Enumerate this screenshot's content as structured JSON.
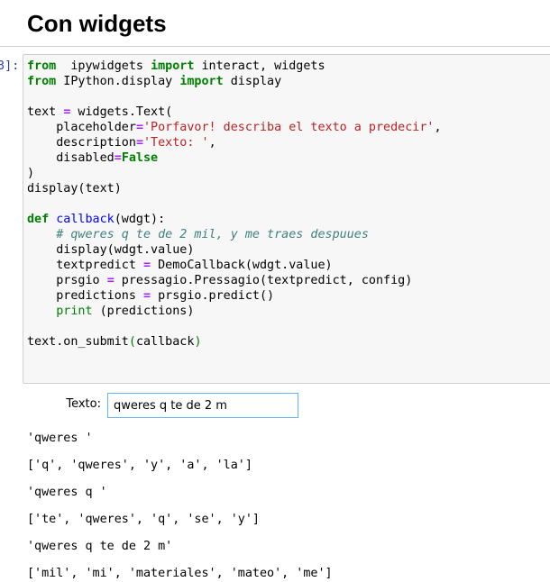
{
  "heading": "Con widgets",
  "cell_prompt": "3]:",
  "code_lines": [
    [
      [
        "kw",
        "from"
      ],
      [
        "",
        "  ipywidgets "
      ],
      [
        "kw",
        "import"
      ],
      [
        "",
        " interact, widgets"
      ]
    ],
    [
      [
        "kw",
        "from"
      ],
      [
        "",
        " IPython.display "
      ],
      [
        "kw",
        "import"
      ],
      [
        "",
        " display"
      ]
    ],
    [],
    [
      [
        "",
        "text "
      ],
      [
        "op",
        "="
      ],
      [
        "",
        " widgets.Text("
      ]
    ],
    [
      [
        "",
        "    placeholder"
      ],
      [
        "op",
        "="
      ],
      [
        "st",
        "'Porfavor! describa el texto a predecir'"
      ],
      [
        "",
        ","
      ]
    ],
    [
      [
        "",
        "    description"
      ],
      [
        "op",
        "="
      ],
      [
        "st",
        "'Texto: '"
      ],
      [
        "",
        ","
      ]
    ],
    [
      [
        "",
        "    disabled"
      ],
      [
        "op",
        "="
      ],
      [
        "kw",
        "False"
      ]
    ],
    [
      [
        "",
        ")"
      ]
    ],
    [
      [
        "",
        "display(text)"
      ]
    ],
    [],
    [
      [
        "kw",
        "def"
      ],
      [
        "",
        " "
      ],
      [
        "fn",
        "callback"
      ],
      [
        "",
        "(wdgt):"
      ]
    ],
    [
      [
        "cm",
        "    # qweres q te de 2 mil, y me traes despuues"
      ]
    ],
    [
      [
        "",
        "    display(wdgt.value)"
      ]
    ],
    [
      [
        "",
        "    textpredict "
      ],
      [
        "op",
        "="
      ],
      [
        "",
        " DemoCallback(wdgt.value)"
      ]
    ],
    [
      [
        "",
        "    prsgio "
      ],
      [
        "op",
        "="
      ],
      [
        "",
        " pressagio.Pressagio(textpredict, config)"
      ]
    ],
    [
      [
        "",
        "    predictions "
      ],
      [
        "op",
        "="
      ],
      [
        "",
        " prsgio.predict()"
      ]
    ],
    [
      [
        "pr",
        "    print"
      ],
      [
        "",
        " (predictions)"
      ]
    ],
    [],
    [
      [
        "",
        "text.on_submit"
      ],
      [
        "pr",
        "("
      ],
      [
        "",
        "callback"
      ],
      [
        "pr",
        ")"
      ]
    ]
  ],
  "widget": {
    "label": "Texto:",
    "value": "qweres q te de 2 m",
    "placeholder": "Porfavor! describa el texto a predecir"
  },
  "outputs": [
    "'qweres '",
    "['q', 'qweres', 'y', 'a', 'la']",
    "'qweres q '",
    "['te', 'qweres', 'q', 'se', 'y']",
    "'qweres q te de 2 m'",
    "['mil', 'mi', 'materiales', 'mateo', 'me']"
  ]
}
